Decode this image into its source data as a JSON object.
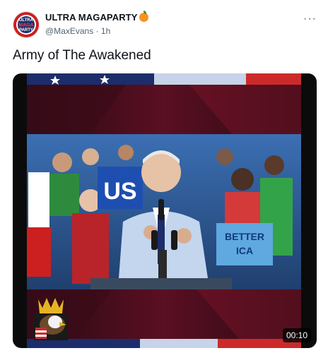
{
  "tweet": {
    "author": {
      "display_name": "ULTRA MAGAPARTY",
      "handle": "@MaxEvans",
      "time": "1h",
      "separator": "·",
      "avatar_text_lines": [
        "ULTRA",
        "MAGA",
        "PARTY"
      ],
      "badge_icon": "orange-emoji-icon"
    },
    "more_label": "···",
    "text": "Army of The Awakened",
    "media": {
      "duration": "00:10",
      "sign_texts": [
        "US",
        "BETTER",
        "ICA"
      ],
      "overlay_icon": "eagle-crown-logo-icon"
    }
  }
}
